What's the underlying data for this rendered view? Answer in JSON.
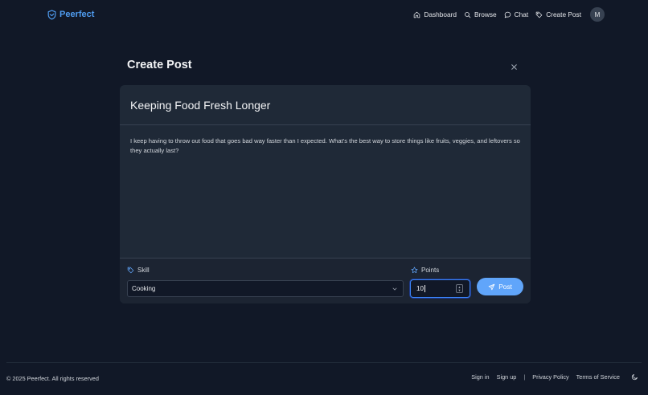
{
  "header": {
    "brand": "Peerfect",
    "nav": [
      {
        "label": "Dashboard",
        "icon": "home-icon"
      },
      {
        "label": "Browse",
        "icon": "search-icon"
      },
      {
        "label": "Chat",
        "icon": "chat-icon"
      },
      {
        "label": "Create Post",
        "icon": "tag-icon"
      }
    ],
    "avatar_initial": "M"
  },
  "main": {
    "title": "Create Post",
    "post": {
      "title": "Keeping Food Fresh Longer",
      "body": "I keep having to throw out food that goes bad way faster than I expected. What’s the best way to store things like fruits, veggies, and leftovers so they actually last?"
    },
    "skill": {
      "label": "Skill",
      "value": "Cooking"
    },
    "points": {
      "label": "Points",
      "value": "10"
    },
    "post_button": "Post"
  },
  "footer": {
    "copyright": "© 2025 Peerfect. All rights reserved",
    "links": [
      "Sign in",
      "Sign up",
      "Privacy Policy",
      "Terms of Service"
    ],
    "separator": "|"
  },
  "colors": {
    "background": "#111827",
    "card": "#1f2937",
    "accent": "#60a5fa",
    "brand": "#4f9cf0"
  }
}
